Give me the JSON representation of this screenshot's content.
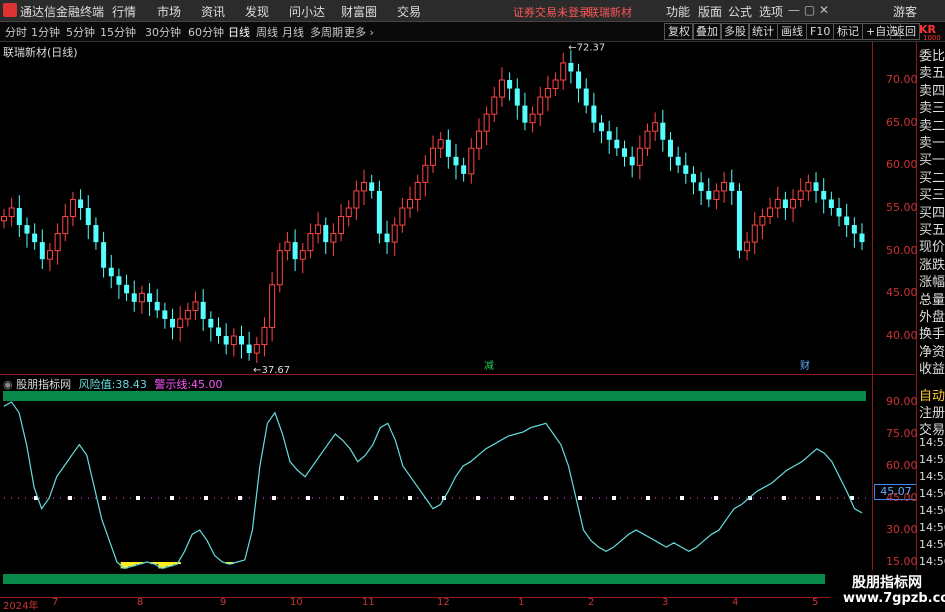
{
  "app": {
    "title": "通达信金融终端",
    "menus": [
      "行情",
      "市场",
      "资讯",
      "发现",
      "问小达",
      "财富圈",
      "交易"
    ],
    "login_status": "证券交易未登录",
    "stock_link": "联瑞新材",
    "right_menus": [
      "功能",
      "版面",
      "公式",
      "选项"
    ],
    "window_buttons": "— ▢ ✕",
    "guest": "游客"
  },
  "periods": {
    "items": [
      "分时",
      "1分钟",
      "5分钟",
      "15分钟",
      "30分钟",
      "60分钟",
      "日线",
      "周线",
      "月线",
      "多周期",
      "更多 ›"
    ],
    "active": "日线"
  },
  "toolbar": {
    "items": [
      "复权",
      "叠加",
      "多股",
      "统计",
      "画线",
      "F10",
      "标记",
      "+自选",
      "返回"
    ]
  },
  "main_chart": {
    "stock_title": "联瑞新材(日线)",
    "high_label": "72.37",
    "low_label": "37.67",
    "markers": [
      "减",
      "财"
    ],
    "marker_colors": [
      "#22cc55",
      "#66aaff"
    ],
    "y_ticks": [
      "70.00",
      "65.00",
      "60.00",
      "55.00",
      "50.00",
      "45.00",
      "40.00"
    ],
    "up_color": "#ff4444",
    "down_color": "#55ffff"
  },
  "indicator": {
    "name": "股朋指标网",
    "risk_label": "风险值:",
    "risk_value": "38.43",
    "warn_label": "警示线:",
    "warn_value": "45.00",
    "y_ticks": [
      "90.00",
      "75.00",
      "60.00",
      "45.00",
      "30.00",
      "15.00"
    ],
    "current_value_badge": "45.07",
    "line_color": "#66dddd",
    "fill_color": "#ffee22",
    "band_color": "#0a8a4a"
  },
  "date_axis": {
    "labels": [
      "2024年",
      "7",
      "8",
      "9",
      "10",
      "11",
      "12",
      "1",
      "2",
      "3",
      "4",
      "5"
    ]
  },
  "right_panel": {
    "top_label": "KR",
    "top_sub": "1000",
    "labels": [
      "委比",
      "卖五",
      "卖四",
      "卖三",
      "卖二",
      "卖一",
      "买一",
      "买二",
      "买三",
      "买四",
      "买五",
      "现价",
      "涨跌",
      "涨幅",
      "总量",
      "外盘",
      "换手",
      "净资",
      "收益"
    ],
    "lower_labels": [
      "自动",
      "注册",
      "交易",
      "14:55",
      "14:55",
      "14:55",
      "14:56",
      "14:56",
      "14:56",
      "14:56",
      "14:56"
    ]
  },
  "watermark": {
    "line1": "股朋指标网",
    "line2": "www.7gpzb.com"
  },
  "chart_data": [
    {
      "type": "candlestick",
      "title": "联瑞新材(日线)",
      "ylim": [
        37.0,
        74.0
      ],
      "close_series": [
        54,
        55,
        53,
        52,
        51,
        49,
        50,
        52,
        54,
        56,
        55,
        53,
        51,
        48,
        47,
        46,
        45,
        44,
        45,
        44,
        43,
        42,
        41,
        42,
        43,
        44,
        42,
        41,
        40,
        39,
        40,
        39,
        38,
        39,
        41,
        46,
        50,
        51,
        49,
        50,
        52,
        53,
        51,
        52,
        54,
        55,
        57,
        58,
        57,
        52,
        51,
        53,
        55,
        56,
        58,
        60,
        62,
        63,
        61,
        60,
        59,
        62,
        64,
        66,
        68,
        70,
        69,
        67,
        65,
        66,
        68,
        69,
        70,
        72,
        71,
        69,
        67,
        65,
        64,
        63,
        62,
        61,
        60,
        62,
        64,
        65,
        63,
        61,
        60,
        59,
        58,
        57,
        56,
        57,
        58,
        57,
        50,
        51,
        53,
        54,
        55,
        56,
        55,
        56,
        57,
        58,
        57,
        56,
        55,
        54,
        53,
        52,
        51
      ]
    },
    {
      "type": "line",
      "title": "股朋指标网",
      "ylim": [
        15,
        95
      ],
      "warn_line": 45,
      "risk_value": 38.43,
      "values": [
        88,
        90,
        85,
        70,
        50,
        40,
        45,
        55,
        60,
        65,
        70,
        65,
        50,
        35,
        25,
        15,
        12,
        13,
        14,
        15,
        14,
        12,
        13,
        14,
        20,
        28,
        30,
        25,
        18,
        15,
        14,
        15,
        16,
        30,
        60,
        80,
        85,
        75,
        62,
        58,
        55,
        60,
        65,
        70,
        75,
        72,
        68,
        62,
        65,
        70,
        78,
        80,
        72,
        60,
        55,
        50,
        45,
        40,
        42,
        48,
        55,
        60,
        62,
        65,
        68,
        70,
        72,
        74,
        75,
        76,
        78,
        79,
        80,
        75,
        70,
        60,
        45,
        30,
        25,
        22,
        20,
        22,
        25,
        28,
        30,
        28,
        26,
        24,
        22,
        24,
        22,
        20,
        22,
        25,
        28,
        30,
        35,
        40,
        42,
        45,
        48,
        50,
        52,
        55,
        58,
        60,
        62,
        65,
        68,
        66,
        62,
        55,
        48,
        40,
        38
      ]
    }
  ]
}
